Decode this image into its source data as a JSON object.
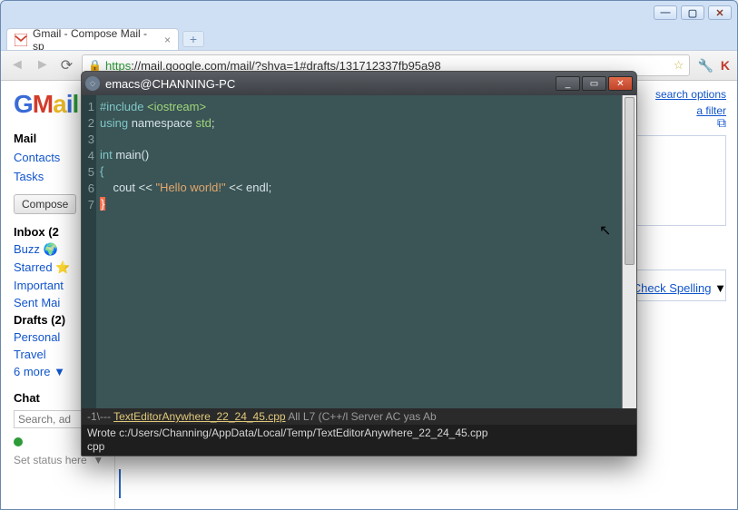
{
  "browser": {
    "win_controls": {
      "min": "—",
      "max": "▢",
      "close": "✕"
    },
    "tab": {
      "title": "Gmail - Compose Mail - sp",
      "favicon_letter": "M",
      "close": "×"
    },
    "newtab_label": "+",
    "nav": {
      "back": "◄",
      "forward": "►",
      "reload": "⟳"
    },
    "url_https": "https",
    "url_rest": "://mail.google.com/mail/?shva=1#drafts/131712337fb95a98",
    "lock": "🔒",
    "star": "☆",
    "wrench": "🔧",
    "kaspersky": "K"
  },
  "gmail": {
    "logo_letters": [
      "G",
      "M",
      "a",
      "i",
      "l"
    ],
    "mail": "Mail",
    "contacts": "Contacts",
    "tasks": "Tasks",
    "compose": "Compose",
    "folders": [
      {
        "label": "Inbox (2",
        "bold": true
      },
      {
        "label": "Buzz 🌍",
        "bold": false
      },
      {
        "label": "Starred ⭐",
        "bold": false
      },
      {
        "label": "Important",
        "bold": false
      },
      {
        "label": "Sent Mai",
        "bold": false
      },
      {
        "label": "Drafts (2)",
        "bold": true
      },
      {
        "label": "Personal",
        "bold": false
      },
      {
        "label": "Travel",
        "bold": false
      },
      {
        "label": "6 more ▼",
        "bold": false
      }
    ],
    "chat_head": "Chat",
    "chat_placeholder": "Search, ad",
    "status_text": "Set status here",
    "status_caret": "▼",
    "right_links": {
      "search": "search options",
      "filter": "a filter"
    },
    "popout": "⧉",
    "check_spelling": "Check Spelling",
    "caret": "▼"
  },
  "emacs": {
    "title": "emacs@CHANNING-PC",
    "btns": {
      "min": "_",
      "max": "▭",
      "close": "✕"
    },
    "gutter": [
      "1",
      "2",
      "3",
      "4",
      "5",
      "6",
      "7"
    ],
    "code": {
      "l1a": "#include ",
      "l1b": "<iostream>",
      "l2a": "using",
      "l2b": " namespace ",
      "l2c": "std",
      "l2d": ";",
      "l4a": "int",
      "l4b": " main()",
      "l5": "{",
      "l6a": "    cout << ",
      "l6b": "\"Hello world!\"",
      "l6c": " << endl;",
      "l7": "}"
    },
    "modeline_pre": "-1\\--- ",
    "modeline_file": "TextEditorAnywhere_22_24_45.cpp",
    "modeline_post": "   All L7    (C++/l Server AC yas Ab",
    "minibuffer": "Wrote c:/Users/Channing/AppData/Local/Temp/TextEditorAnywhere_22_24_45.cpp",
    "minibuffer2": "cpp"
  }
}
